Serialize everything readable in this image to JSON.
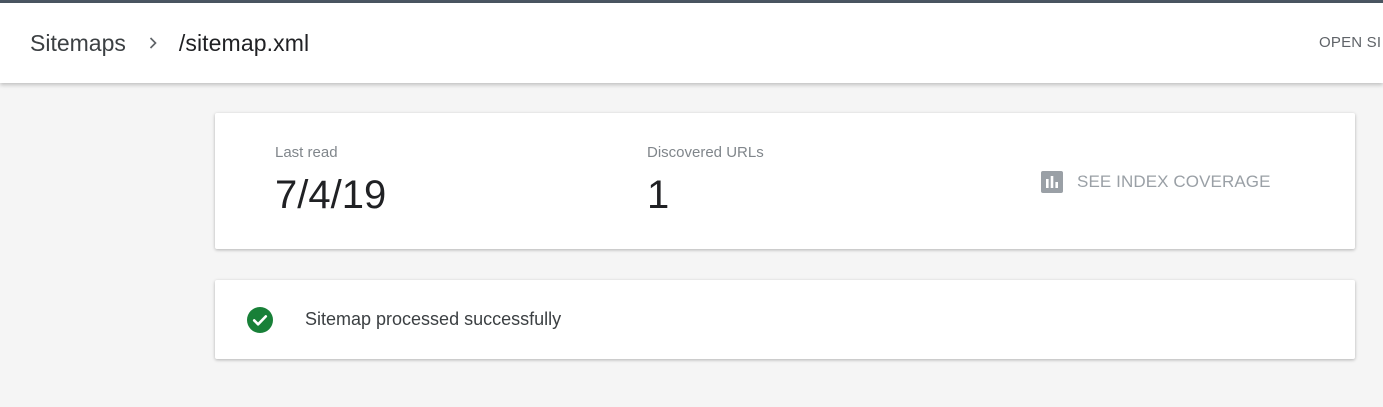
{
  "header": {
    "breadcrumb_parent": "Sitemaps",
    "breadcrumb_current": "/sitemap.xml",
    "open_link": "OPEN SI",
    "separator_icon": "chevron-right-icon"
  },
  "stats": {
    "last_read_label": "Last read",
    "last_read_value": "7/4/19",
    "discovered_urls_label": "Discovered URLs",
    "discovered_urls_value": "1"
  },
  "coverage": {
    "label": "SEE INDEX COVERAGE",
    "icon": "bar-chart-icon"
  },
  "status": {
    "text": "Sitemap processed successfully",
    "icon": "check-circle-icon"
  },
  "colors": {
    "top_strip": "#4a5662",
    "page_background": "#f5f5f5",
    "success": "#188038",
    "muted_icon": "#9aa0a6",
    "text_primary": "#202124",
    "text_secondary": "#80868b"
  }
}
